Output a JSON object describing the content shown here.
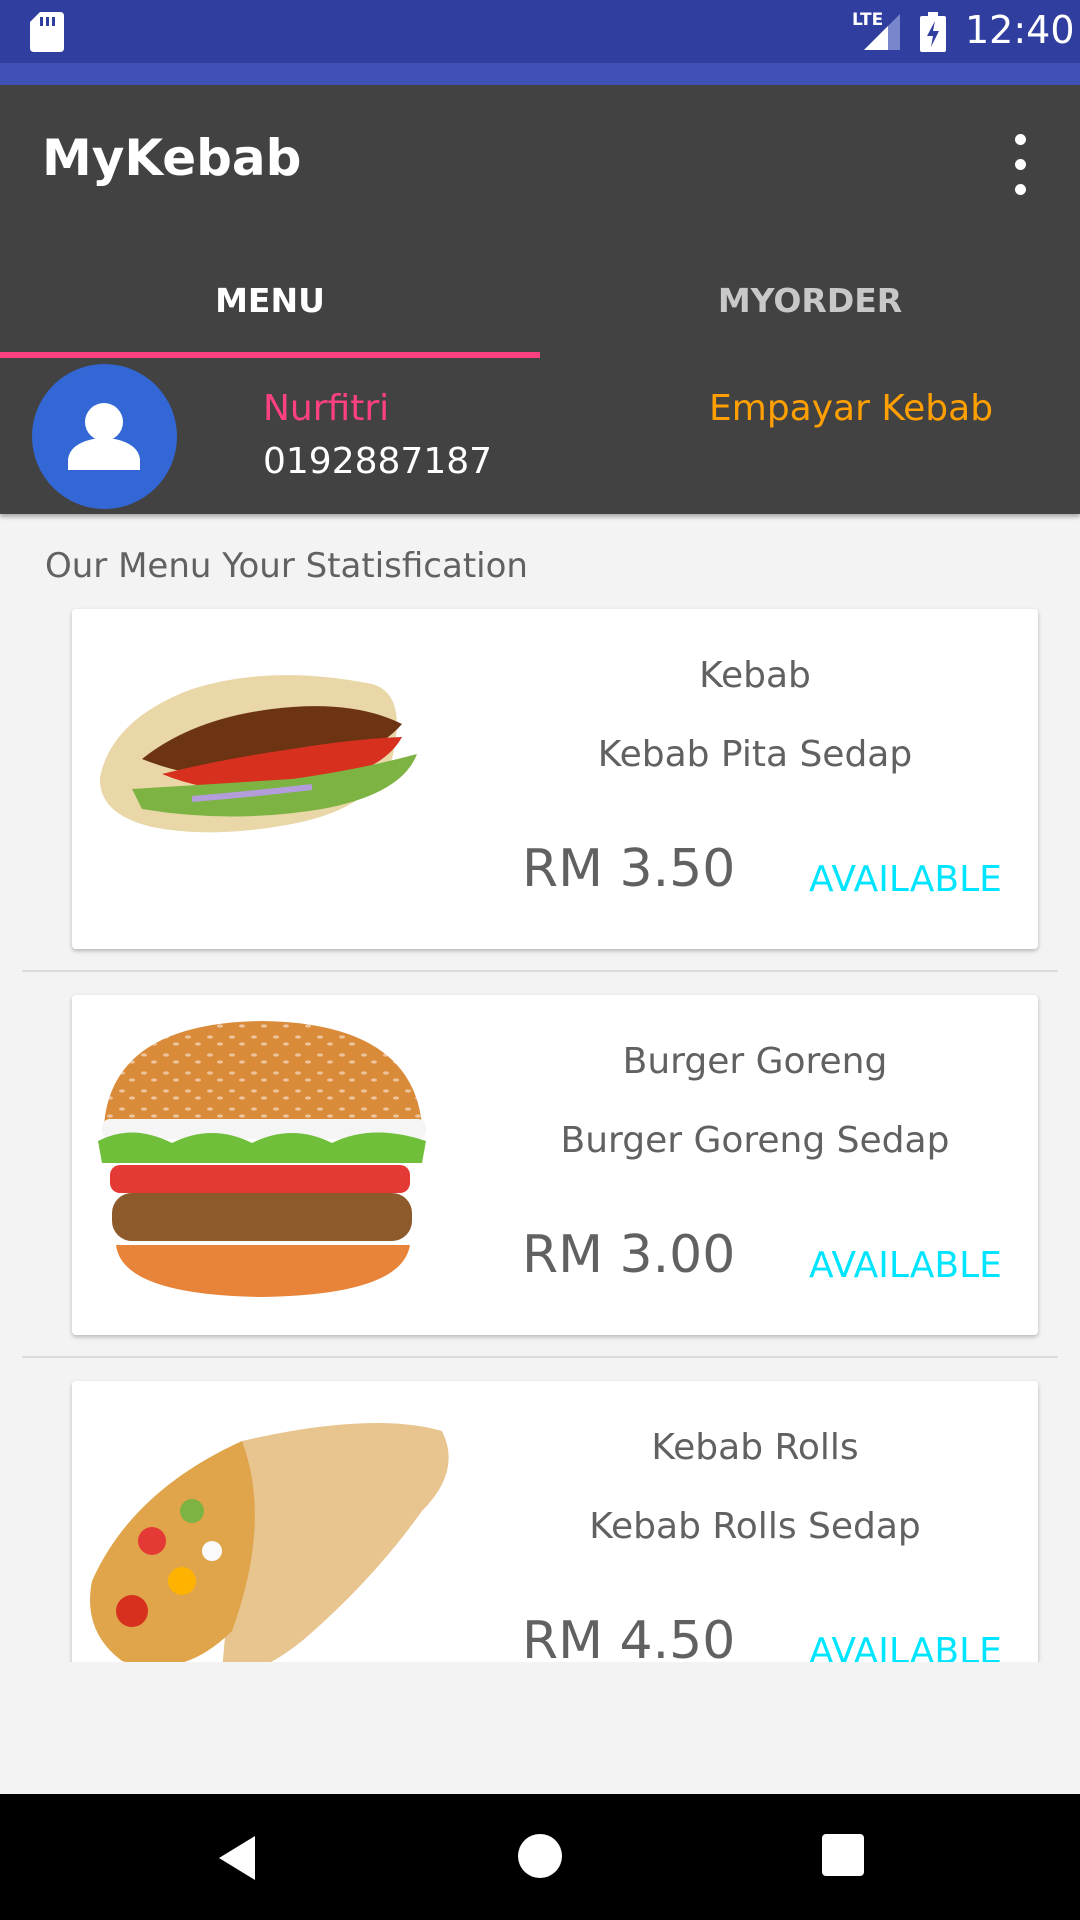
{
  "status_bar": {
    "time": "12:40",
    "network": "LTE",
    "icons": [
      "sd-card-icon",
      "signal-icon",
      "battery-charging-icon"
    ]
  },
  "app_bar": {
    "title": "MyKebab",
    "overflow_icon": "more-vert-icon",
    "tabs": [
      {
        "label": "MENU",
        "selected": true
      },
      {
        "label": "MYORDER",
        "selected": false
      }
    ]
  },
  "profile": {
    "avatar_icon": "person-icon",
    "name": "Nurfitri",
    "phone": "0192887187",
    "shop": "Empayar Kebab"
  },
  "menu": {
    "heading": "Our Menu Your Statisfication",
    "items": [
      {
        "name": "Kebab",
        "description": "Kebab Pita Sedap",
        "price": "RM 3.50",
        "status": "AVAILABLE",
        "image": "kebab-pita-image"
      },
      {
        "name": "Burger Goreng",
        "description": "Burger Goreng Sedap",
        "price": "RM 3.00",
        "status": "AVAILABLE",
        "image": "burger-image"
      },
      {
        "name": "Kebab Rolls",
        "description": "Kebab Rolls Sedap",
        "price": "RM 4.50",
        "status": "AVAILABLE",
        "image": "kebab-roll-image"
      }
    ]
  },
  "nav_bar": {
    "icons": [
      "back-icon",
      "home-icon",
      "recents-icon"
    ]
  },
  "colors": {
    "status_bar": "#303f9f",
    "app_bar": "#424242",
    "tab_indicator": "#ff4081",
    "name_accent": "#ff4081",
    "shop_accent": "#ffa000",
    "available": "#00e5ff"
  }
}
